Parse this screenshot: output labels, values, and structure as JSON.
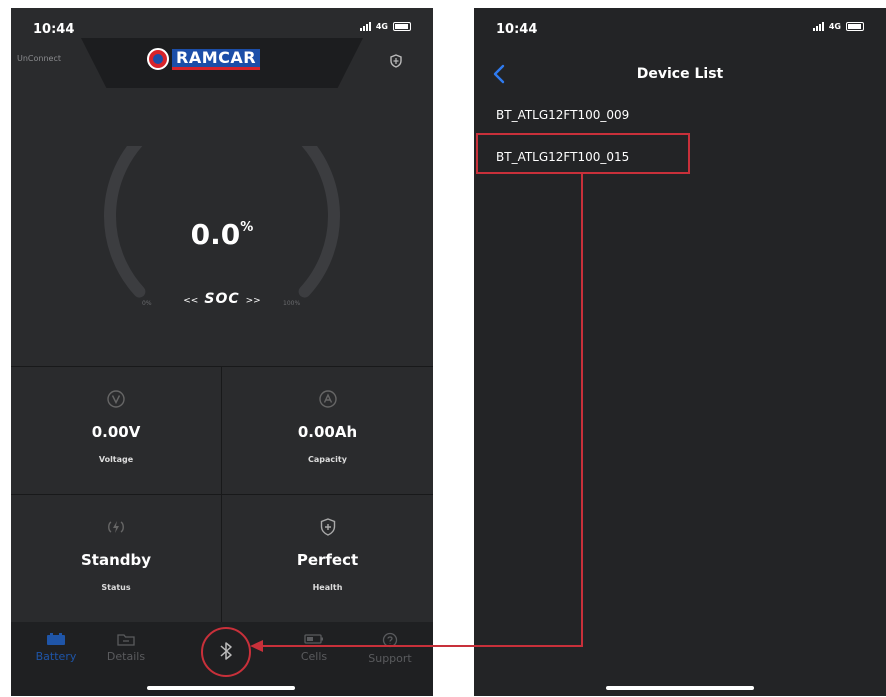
{
  "left_screen": {
    "status_bar": {
      "time": "10:44",
      "network": "4G"
    },
    "header": {
      "connection_status": "UnConnect",
      "brand": "RAMCAR"
    },
    "gauge": {
      "value": "0.0",
      "unit": "%",
      "label": "SOC",
      "label_prefix": "<<",
      "label_suffix": ">>",
      "min_label": "0%",
      "max_label": "100%"
    },
    "stats": [
      {
        "value": "0.00V",
        "label": "Voltage",
        "icon": "voltage-icon"
      },
      {
        "value": "0.00Ah",
        "label": "Capacity",
        "icon": "ampere-icon"
      },
      {
        "value": "Standby",
        "label": "Status",
        "icon": "charging-icon"
      },
      {
        "value": "Perfect",
        "label": "Health",
        "icon": "shield-plus-icon"
      }
    ],
    "tabs": [
      {
        "label": "Battery",
        "active": true
      },
      {
        "label": "Details",
        "active": false
      },
      {
        "label": "Cells",
        "active": false
      },
      {
        "label": "Support",
        "active": false
      }
    ]
  },
  "right_screen": {
    "status_bar": {
      "time": "10:44",
      "network": "4G"
    },
    "nav_title": "Device List",
    "devices": [
      "BT_ATLG12FT100_009",
      "BT_ATLG12FT100_015"
    ]
  },
  "colors": {
    "background": "#2a2b2d",
    "highlight": "#c8303a",
    "accent": "#1f55a8",
    "text": "#ffffff"
  }
}
